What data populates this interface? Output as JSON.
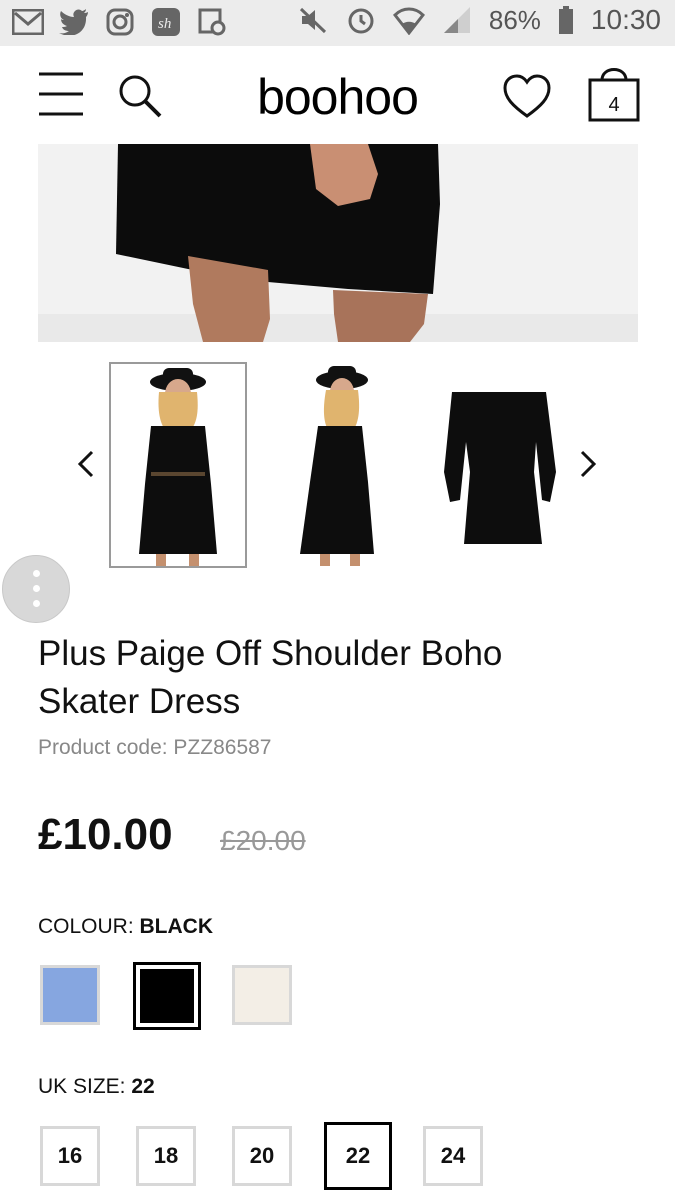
{
  "status_bar": {
    "battery": "86%",
    "time": "10:30"
  },
  "header": {
    "logo": "boohoo",
    "bag_count": "4"
  },
  "product": {
    "title": "Plus Paige Off Shoulder Boho Skater Dress",
    "code_label": "Product code: ",
    "code": "PZZ86587",
    "price": "£10.00",
    "old_price": "£20.00"
  },
  "colour": {
    "label": "COLOUR: ",
    "selected": "BLACK",
    "swatches": [
      {
        "name": "blue",
        "color": "#86a6e0"
      },
      {
        "name": "black",
        "color": "#000000"
      },
      {
        "name": "cream",
        "color": "#f3eee6"
      }
    ]
  },
  "size": {
    "label": "UK SIZE: ",
    "selected": "22",
    "options": [
      "16",
      "18",
      "20",
      "22",
      "24"
    ]
  }
}
